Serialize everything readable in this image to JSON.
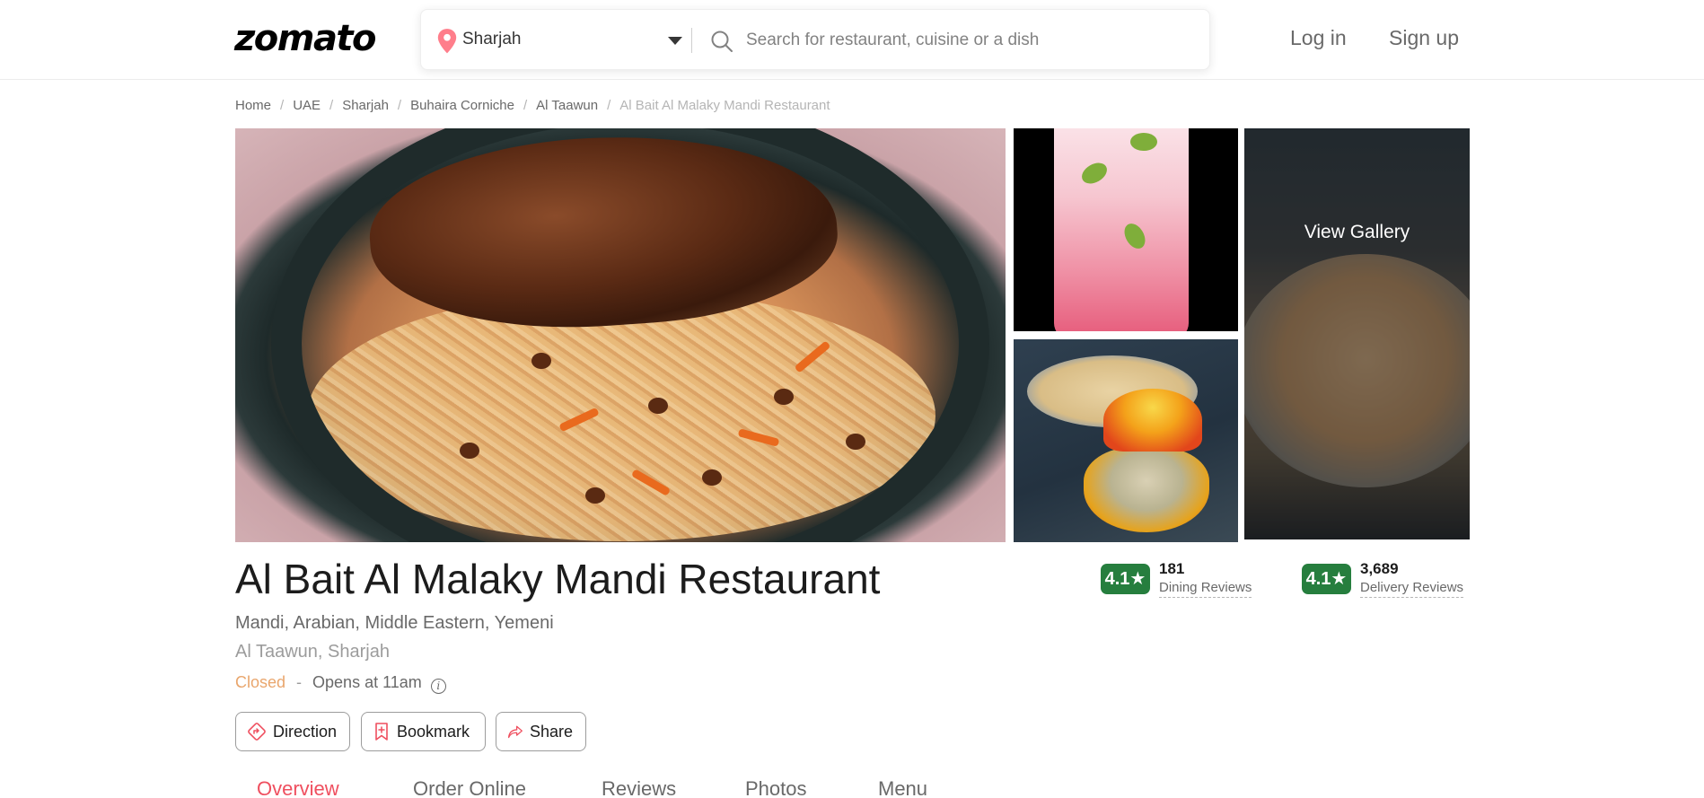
{
  "header": {
    "logo": "zomato",
    "location": "Sharjah",
    "search_placeholder": "Search for restaurant, cuisine or a dish",
    "login_label": "Log in",
    "signup_label": "Sign up"
  },
  "breadcrumb": {
    "items": [
      "Home",
      "UAE",
      "Sharjah",
      "Buhaira Corniche",
      "Al Taawun"
    ],
    "current": "Al Bait Al Malaky Mandi Restaurant"
  },
  "gallery": {
    "view_label": "View Gallery"
  },
  "restaurant": {
    "name": "Al Bait Al Malaky Mandi Restaurant",
    "cuisines": "Mandi, Arabian, Middle Eastern, Yemeni",
    "locality": "Al Taawun, Sharjah",
    "status": "Closed",
    "status_separator": "-",
    "hours": "Opens at 11am"
  },
  "ratings": {
    "dining": {
      "score": "4.1★",
      "count": "181",
      "label": "Dining Reviews"
    },
    "delivery": {
      "score": "4.1★",
      "count": "3,689",
      "label": "Delivery Reviews"
    }
  },
  "actions": {
    "direction": "Direction",
    "bookmark": "Bookmark",
    "share": "Share"
  },
  "tabs": [
    "Overview",
    "Order Online",
    "Reviews",
    "Photos",
    "Menu"
  ],
  "colors": {
    "brand_accent": "#ef4f5f",
    "rating_green": "#267e3e",
    "closed_orange": "#e9a66d"
  }
}
